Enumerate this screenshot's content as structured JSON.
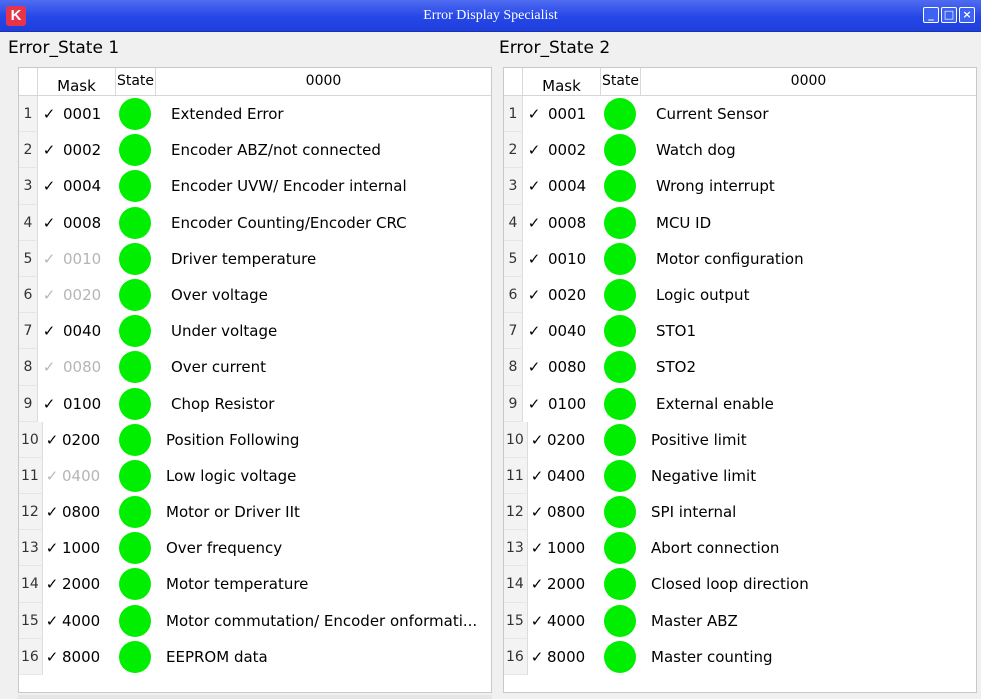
{
  "window": {
    "title": "Error Display Specialist",
    "app_icon": "K",
    "buttons": [
      "_",
      "□",
      "×"
    ]
  },
  "colors": {
    "title_bar": "#2547e8",
    "led_ok": "#00ef00"
  },
  "panels": [
    {
      "title": "Error_State 1",
      "headers": {
        "mask": "Mask",
        "state": "State",
        "desc": "0000"
      },
      "rows": [
        {
          "num": "1",
          "check": "✓",
          "mask": "0001",
          "label": "Extended Error",
          "enabled": true
        },
        {
          "num": "2",
          "check": "✓",
          "mask": "0002",
          "label": "Encoder ABZ/not connected",
          "enabled": true
        },
        {
          "num": "3",
          "check": "✓",
          "mask": "0004",
          "label": "Encoder UVW/ Encoder internal",
          "enabled": true
        },
        {
          "num": "4",
          "check": "✓",
          "mask": "0008",
          "label": "Encoder Counting/Encoder CRC",
          "enabled": true
        },
        {
          "num": "5",
          "check": "✓",
          "mask": "0010",
          "label": "Driver temperature",
          "enabled": false
        },
        {
          "num": "6",
          "check": "✓",
          "mask": "0020",
          "label": "Over voltage",
          "enabled": false
        },
        {
          "num": "7",
          "check": "✓",
          "mask": "0040",
          "label": "Under voltage",
          "enabled": true
        },
        {
          "num": "8",
          "check": "✓",
          "mask": "0080",
          "label": "Over current",
          "enabled": false
        },
        {
          "num": "9",
          "check": "✓",
          "mask": "0100",
          "label": "Chop Resistor",
          "enabled": true
        },
        {
          "num": "10",
          "check": "✓",
          "mask": "0200",
          "label": "Position Following",
          "enabled": true
        },
        {
          "num": "11",
          "check": "✓",
          "mask": "0400",
          "label": "Low logic voltage",
          "enabled": false
        },
        {
          "num": "12",
          "check": "✓",
          "mask": "0800",
          "label": "Motor or Driver IIt",
          "enabled": true
        },
        {
          "num": "13",
          "check": "✓",
          "mask": "1000",
          "label": "Over frequency",
          "enabled": true
        },
        {
          "num": "14",
          "check": "✓",
          "mask": "2000",
          "label": "Motor temperature",
          "enabled": true
        },
        {
          "num": "15",
          "check": "✓",
          "mask": "4000",
          "label": "Motor commutation/ Encoder onformati...",
          "enabled": true
        },
        {
          "num": "16",
          "check": "✓",
          "mask": "8000",
          "label": "EEPROM data",
          "enabled": true
        }
      ]
    },
    {
      "title": "Error_State 2",
      "headers": {
        "mask": "Mask",
        "state": "State",
        "desc": "0000"
      },
      "rows": [
        {
          "num": "1",
          "check": "✓",
          "mask": "0001",
          "label": "Current Sensor",
          "enabled": true
        },
        {
          "num": "2",
          "check": "✓",
          "mask": "0002",
          "label": "Watch dog",
          "enabled": true
        },
        {
          "num": "3",
          "check": "✓",
          "mask": "0004",
          "label": "Wrong interrupt",
          "enabled": true
        },
        {
          "num": "4",
          "check": "✓",
          "mask": "0008",
          "label": "MCU ID",
          "enabled": true
        },
        {
          "num": "5",
          "check": "✓",
          "mask": "0010",
          "label": "Motor configuration",
          "enabled": true
        },
        {
          "num": "6",
          "check": "✓",
          "mask": "0020",
          "label": "Logic output",
          "enabled": true
        },
        {
          "num": "7",
          "check": "✓",
          "mask": "0040",
          "label": "STO1",
          "enabled": true
        },
        {
          "num": "8",
          "check": "✓",
          "mask": "0080",
          "label": "STO2",
          "enabled": true
        },
        {
          "num": "9",
          "check": "✓",
          "mask": "0100",
          "label": "External enable",
          "enabled": true
        },
        {
          "num": "10",
          "check": "✓",
          "mask": "0200",
          "label": "Positive limit",
          "enabled": true
        },
        {
          "num": "11",
          "check": "✓",
          "mask": "0400",
          "label": "Negative limit",
          "enabled": true
        },
        {
          "num": "12",
          "check": "✓",
          "mask": "0800",
          "label": "SPI internal",
          "enabled": true
        },
        {
          "num": "13",
          "check": "✓",
          "mask": "1000",
          "label": "Abort connection",
          "enabled": true
        },
        {
          "num": "14",
          "check": "✓",
          "mask": "2000",
          "label": "Closed loop direction",
          "enabled": true
        },
        {
          "num": "15",
          "check": "✓",
          "mask": "4000",
          "label": "Master ABZ",
          "enabled": true
        },
        {
          "num": "16",
          "check": "✓",
          "mask": "8000",
          "label": "Master counting",
          "enabled": true
        }
      ]
    }
  ]
}
